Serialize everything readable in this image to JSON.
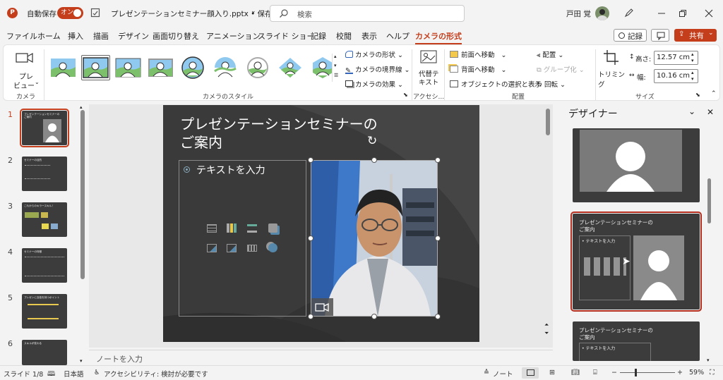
{
  "titlebar": {
    "app_icon": "P",
    "autosave_label": "自動保存",
    "autosave_toggle": "オン",
    "filename": "プレゼンテーションセミナー顔入り.pptx • 保存中...",
    "search_placeholder": "検索",
    "user_name": "戸田 覚"
  },
  "menu": {
    "items": [
      "ファイル",
      "ホーム",
      "挿入",
      "描画",
      "デザイン",
      "画面切り替え",
      "アニメーション",
      "スライド ショー",
      "記録",
      "校閲",
      "表示",
      "ヘルプ",
      "カメラの形式"
    ],
    "record_label": "記録",
    "share_label": "共有"
  },
  "ribbon": {
    "preview_label_1": "プレ",
    "preview_label_2": "ビュー",
    "camera_group": "カメラ",
    "camera_styles_group": "カメラのスタイル",
    "shape_label": "カメラの形状",
    "border_label": "カメラの境界線",
    "effect_label": "カメラの効果",
    "alt_text_1": "代替テ",
    "alt_text_2": "キスト",
    "accessibility_group": "アクセシ...",
    "bring_forward": "前面へ移動",
    "send_backward": "背面へ移動",
    "selection_pane": "オブジェクトの選択と表示",
    "align": "配置",
    "group": "グループ化",
    "rotate": "回転",
    "arrange_group": "配置",
    "crop": "トリミング",
    "height_label": "高さ:",
    "height_value": "12.57 cm",
    "width_label": "幅:",
    "width_value": "10.16 cm",
    "size_group": "サイズ"
  },
  "thumbnails": [
    {
      "num": "1",
      "title": "プレゼンテーションセミナーの\nご案内"
    },
    {
      "num": "2",
      "title": "セミナーの目的"
    },
    {
      "num": "3",
      "title": "これからのキラースキル！"
    },
    {
      "num": "4",
      "title": "セミナーの特徴"
    },
    {
      "num": "5",
      "title": "プレゼンに自信を持つポイント"
    },
    {
      "num": "6",
      "title": "スキルが変わる"
    }
  ],
  "slide": {
    "title_line1": "プレゼンテーションセミナーの",
    "title_line2": "ご案内",
    "placeholder_text": "テキストを入力"
  },
  "notes_placeholder": "ノートを入力",
  "designer": {
    "title": "デザイナー",
    "card2_title_1": "プレゼンテーションセミナーの",
    "card2_title_2": "ご案内",
    "card2_text": "テキストを入力",
    "card3_title_1": "プレゼンテーションセミナーの",
    "card3_title_2": "ご案内",
    "card3_text": "テキストを入力"
  },
  "status": {
    "slide_info": "スライド 1/8",
    "language": "日本語",
    "accessibility": "アクセシビリティ: 検討が必要です",
    "notes": "ノート",
    "zoom": "59%"
  },
  "colors": {
    "accent": "#c43e1c",
    "slide_bg": "#3a3a3a",
    "ribbon_bg": "#ffffff"
  }
}
